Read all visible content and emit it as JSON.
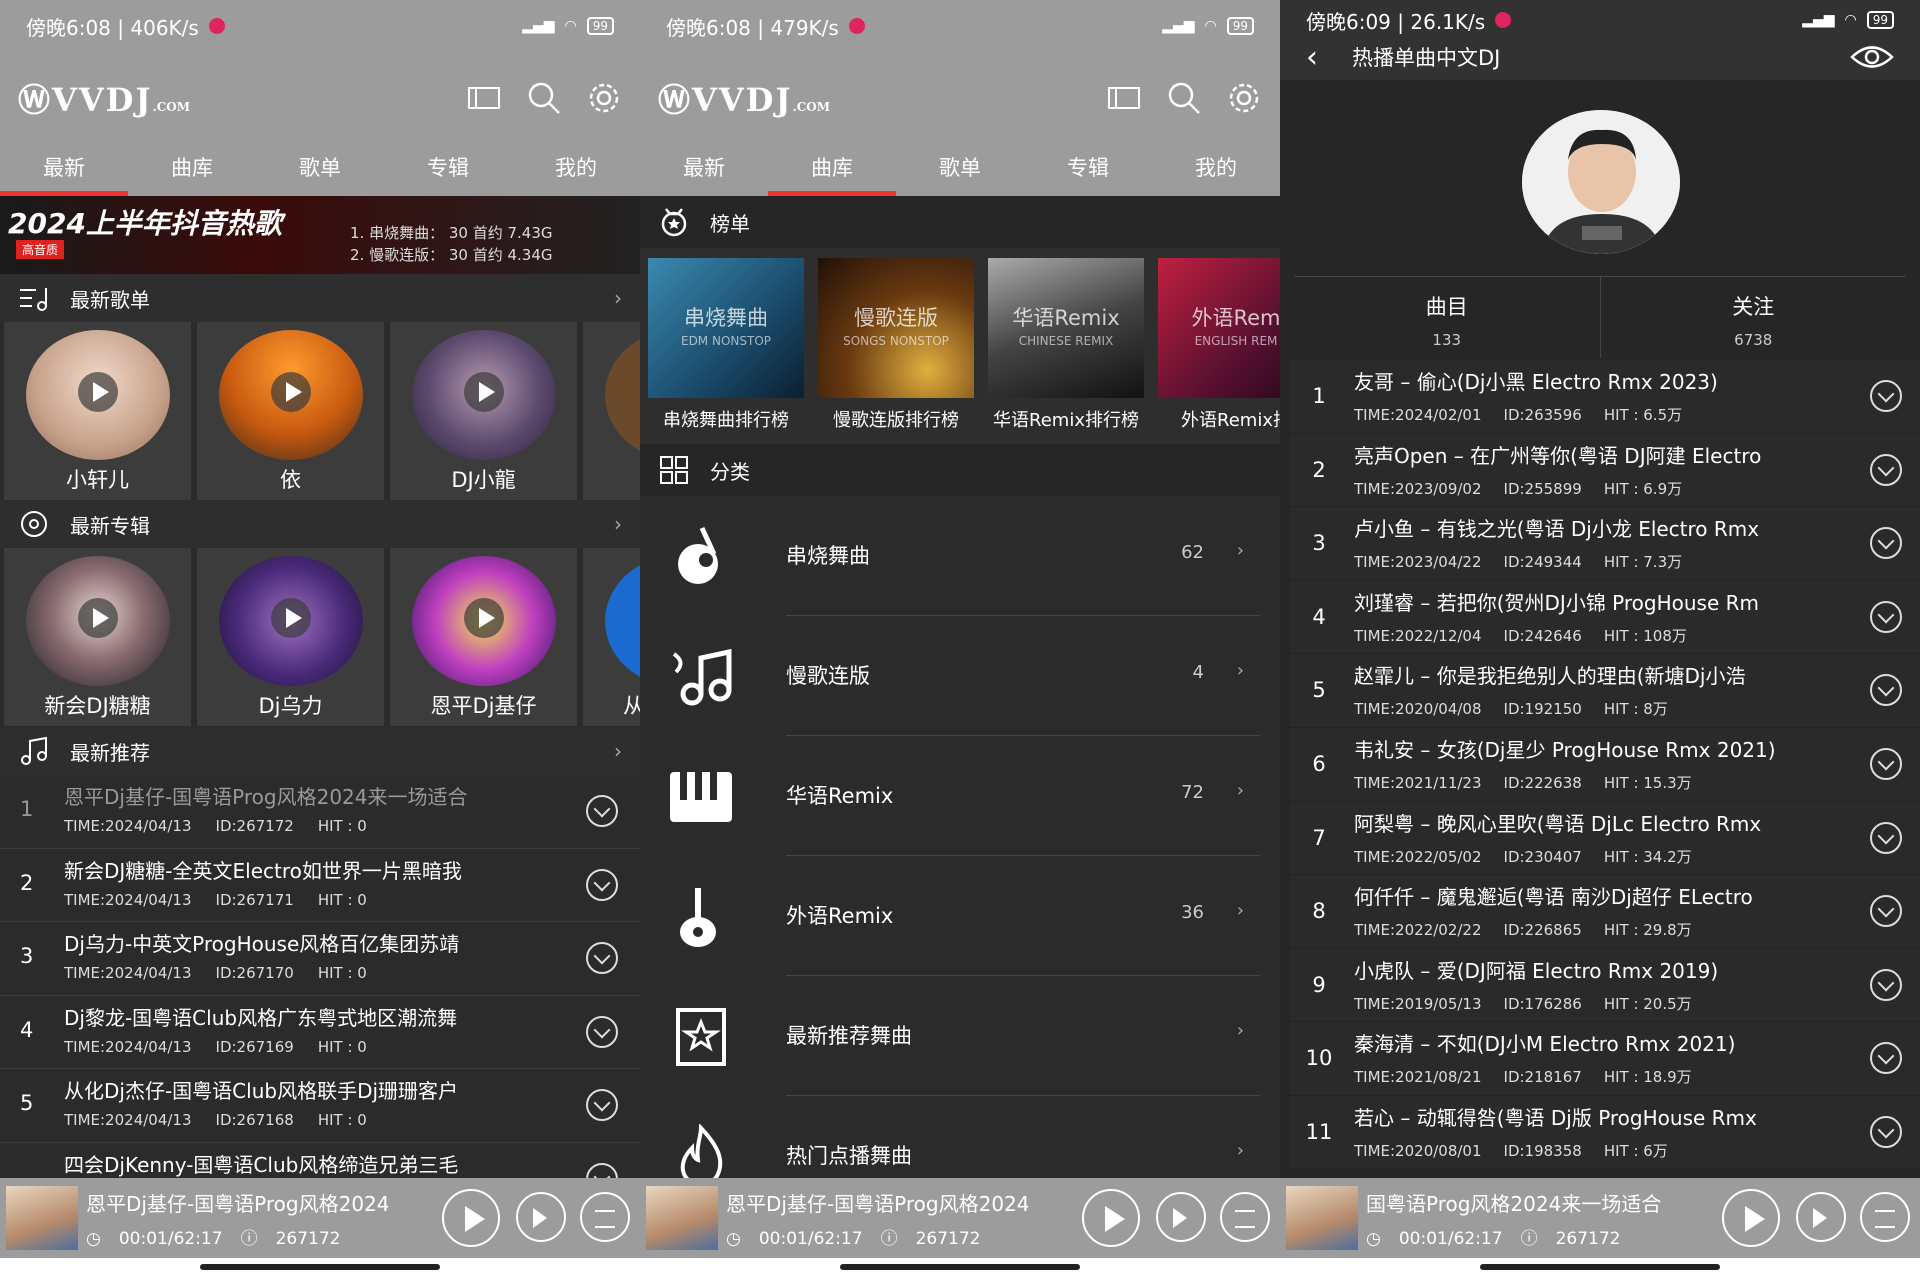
{
  "panel1": {
    "status": {
      "time": "傍晚6:08 | 406K/s",
      "battery": "99"
    },
    "logo": {
      "main": "VVDJ",
      "sub": ".COM"
    },
    "tabs": [
      "最新",
      "曲库",
      "歌单",
      "专辑",
      "我的"
    ],
    "banner": {
      "title": "2024上半年抖音热歌",
      "badge": "高音质",
      "line1": "1. 串烧舞曲：  30 首约 7.43G",
      "line2": "2. 慢歌连版：  30 首约 4.34G"
    },
    "playlist_section": "最新歌单",
    "playlists": [
      "小轩儿",
      "依",
      "DJ小龍"
    ],
    "album_section": "最新专辑",
    "albums": [
      "新会DJ糖糖",
      "Dj乌力",
      "恩平Dj基仔",
      "从"
    ],
    "recommend_section": "最新推荐",
    "recommend": [
      {
        "n": "1",
        "title": "恩平Dj基仔-国粤语Prog风格2024来一场适合",
        "time": "TIME:2024/04/13",
        "id": "ID:267172",
        "hit": "HIT : 0"
      },
      {
        "n": "2",
        "title": "新会DJ糖糖-全英文Electro如世界一片黑暗我",
        "time": "TIME:2024/04/13",
        "id": "ID:267171",
        "hit": "HIT : 0"
      },
      {
        "n": "3",
        "title": "Dj乌力-中英文ProgHouse风格百亿集团苏靖",
        "time": "TIME:2024/04/13",
        "id": "ID:267170",
        "hit": "HIT : 0"
      },
      {
        "n": "4",
        "title": "Dj黎龙-国粤语Club风格广东粤式地区潮流舞",
        "time": "TIME:2024/04/13",
        "id": "ID:267169",
        "hit": "HIT : 0"
      },
      {
        "n": "5",
        "title": "从化Dj杰仔-国粤语Club风格联手Dj珊珊客户",
        "time": "TIME:2024/04/13",
        "id": "ID:267168",
        "hit": "HIT : 0"
      },
      {
        "n": "",
        "title": "四会DjKenny-国粤语Club风格缔造兄弟三毛",
        "time": "",
        "id": "",
        "hit": ""
      }
    ]
  },
  "panel2": {
    "status": {
      "time": "傍晚6:08 | 479K/s",
      "battery": "99"
    },
    "charts_section": "榜单",
    "charts": [
      {
        "img_title": "串烧舞曲",
        "img_sub": "EDM NONSTOP",
        "label": "串烧舞曲排行榜"
      },
      {
        "img_title": "慢歌连版",
        "img_sub": "SONGS NONSTOP",
        "label": "慢歌连版排行榜"
      },
      {
        "img_title": "华语Remix",
        "img_sub": "CHINESE REMIX",
        "label": "华语Remix排行榜"
      },
      {
        "img_title": "外语Rem",
        "img_sub": "ENGLISH REM",
        "label": "外语Remix排"
      }
    ],
    "category_section": "分类",
    "categories": [
      {
        "name": "串烧舞曲",
        "count": "62"
      },
      {
        "name": "慢歌连版",
        "count": "4"
      },
      {
        "name": "华语Remix",
        "count": "72"
      },
      {
        "name": "外语Remix",
        "count": "36"
      },
      {
        "name": "最新推荐舞曲",
        "count": ""
      },
      {
        "name": "热门点播舞曲",
        "count": ""
      }
    ]
  },
  "panel3": {
    "status": {
      "time": "傍晚6:09 | 26.1K/s",
      "battery": "99"
    },
    "title": "热播单曲中文DJ",
    "stats": [
      {
        "label": "曲目",
        "value": "133"
      },
      {
        "label": "关注",
        "value": "6738"
      }
    ],
    "songs": [
      {
        "n": "1",
        "title": "友哥 – 偷心(Dj小黑 Electro Rmx 2023)",
        "time": "TIME:2024/02/01",
        "id": "ID:263596",
        "hit": "HIT : 6.5万"
      },
      {
        "n": "2",
        "title": "亮声Open – 在广州等你(粤语 DJ阿建 Electro",
        "time": "TIME:2023/09/02",
        "id": "ID:255899",
        "hit": "HIT : 6.9万"
      },
      {
        "n": "3",
        "title": "卢小鱼 – 有钱之光(粤语 Dj小龙 Electro Rmx",
        "time": "TIME:2023/04/22",
        "id": "ID:249344",
        "hit": "HIT : 7.3万"
      },
      {
        "n": "4",
        "title": "刘瑾睿 – 若把你(贺州DJ小锦 ProgHouse Rm",
        "time": "TIME:2022/12/04",
        "id": "ID:242646",
        "hit": "HIT : 108万"
      },
      {
        "n": "5",
        "title": "赵霏儿 – 你是我拒绝别人的理由(新塘Dj小浩",
        "time": "TIME:2020/04/08",
        "id": "ID:192150",
        "hit": "HIT : 8万"
      },
      {
        "n": "6",
        "title": "韦礼安 – 女孩(Dj星少 ProgHouse Rmx 2021)",
        "time": "TIME:2021/11/23",
        "id": "ID:222638",
        "hit": "HIT : 15.3万"
      },
      {
        "n": "7",
        "title": "阿梨粤 – 晚风心里吹(粤语 DjLc Electro Rmx",
        "time": "TIME:2022/05/02",
        "id": "ID:230407",
        "hit": "HIT : 34.2万"
      },
      {
        "n": "8",
        "title": "何仟仟 – 魔鬼邂逅(粤语 南沙Dj超仔 ELectro",
        "time": "TIME:2022/02/22",
        "id": "ID:226865",
        "hit": "HIT : 29.8万"
      },
      {
        "n": "9",
        "title": "小虎队 – 爱(DJ阿福 Electro Rmx 2019)",
        "time": "TIME:2019/05/13",
        "id": "ID:176286",
        "hit": "HIT : 20.5万"
      },
      {
        "n": "10",
        "title": "秦海清 – 不如(DJ小M Electro Rmx 2021)",
        "time": "TIME:2021/08/21",
        "id": "ID:218167",
        "hit": "HIT : 18.9万"
      },
      {
        "n": "11",
        "title": "若心 – 动辄得咎(粤语 Dj版 ProgHouse Rmx",
        "time": "TIME:2020/08/01",
        "id": "ID:198358",
        "hit": "HIT : 6万"
      }
    ]
  },
  "player": {
    "title1": "恩平Dj基仔-国粤语Prog风格2024",
    "title3": "国粤语Prog风格2024来一场适合",
    "time": "00:01/62:17",
    "id": "267172"
  }
}
